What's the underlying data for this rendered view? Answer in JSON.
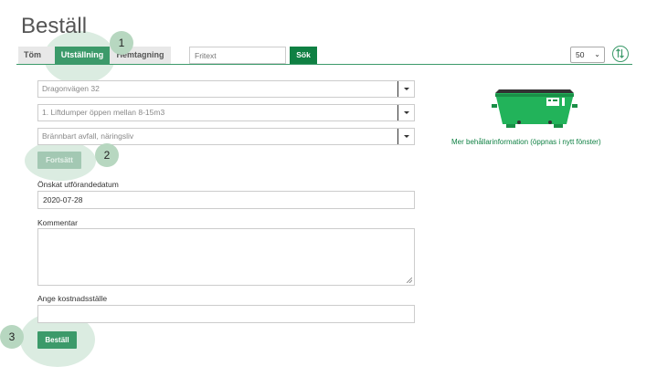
{
  "page": {
    "title": "Beställ"
  },
  "tabs": [
    {
      "label": "Töm"
    },
    {
      "label": "Utställning",
      "active": true
    },
    {
      "label": "Hemtagning"
    }
  ],
  "search": {
    "placeholder": "Fritext",
    "button_label": "Sök"
  },
  "per_page": {
    "value": "50"
  },
  "form": {
    "address": "Dragonvägen 32",
    "container_type": "1. Liftdumper öppen mellan 8-15m3",
    "waste_type": "Brännbart avfall, näringsliv",
    "continue_button": "Fortsätt",
    "date_label": "Önskat utförandedatum",
    "date_value": "2020-07-28",
    "comment_label": "Kommentar",
    "cost_center_label": "Ange kostnadsställe",
    "submit_button": "Beställ"
  },
  "container_info": {
    "link_text": "Mer behållarinformation (öppnas i nytt fönster)"
  },
  "markers": [
    "1",
    "2",
    "3"
  ],
  "colors": {
    "brand_green": "#0f8043",
    "accent_green": "#3c9a6a"
  }
}
